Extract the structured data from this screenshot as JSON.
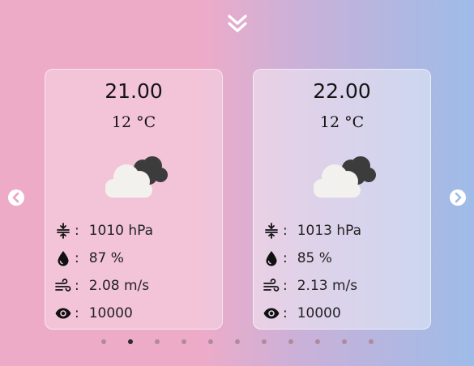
{
  "cards": [
    {
      "date": "21.00",
      "temperature": "12 °C",
      "pressure": "1010 hPa",
      "humidity": "87 %",
      "wind": "2.08 m/s",
      "visibility": "10000"
    },
    {
      "date": "22.00",
      "temperature": "12 °C",
      "pressure": "1013 hPa",
      "humidity": "85 %",
      "wind": "2.13 m/s",
      "visibility": "10000"
    }
  ],
  "separator": ":",
  "pagination": {
    "total": 11,
    "active_index": 1
  },
  "icons": {
    "collapse": "chevron-double-down-icon",
    "prev": "chevron-left-icon",
    "next": "chevron-right-icon",
    "weather": "cloud-icon",
    "pressure": "pressure-icon",
    "humidity": "droplet-icon",
    "wind": "wind-icon",
    "visibility": "eye-icon"
  },
  "colors": {
    "accent_dot": "#2b2b2b",
    "dot": "#b08a9e"
  }
}
